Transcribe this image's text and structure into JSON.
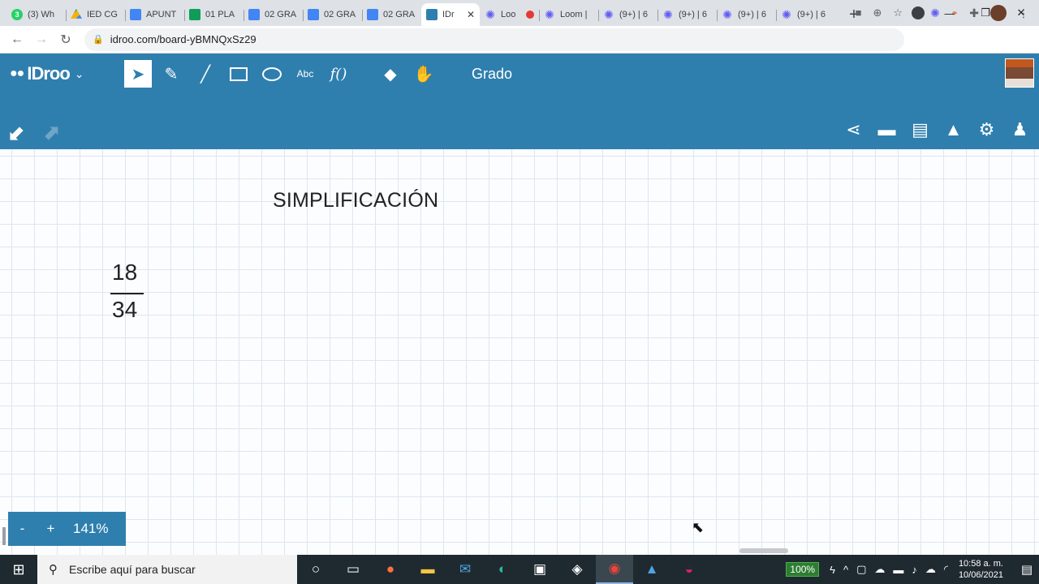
{
  "browser": {
    "tabs": [
      {
        "title": "(3) Wh",
        "icon": "whatsapp-icon",
        "fav": "wa",
        "badge": "3"
      },
      {
        "title": "IED CG",
        "icon": "drive-icon",
        "fav": "drive",
        "badge": ""
      },
      {
        "title": "APUNT",
        "icon": "docs-icon",
        "fav": "doc",
        "badge": ""
      },
      {
        "title": "01 PLA",
        "icon": "sheets-icon",
        "fav": "sheet",
        "badge": ""
      },
      {
        "title": "02 GRA",
        "icon": "docs-icon",
        "fav": "doc",
        "badge": ""
      },
      {
        "title": "02 GRA",
        "icon": "docs-icon",
        "fav": "doc",
        "badge": ""
      },
      {
        "title": "02 GRA",
        "icon": "docs-icon",
        "fav": "doc",
        "badge": ""
      },
      {
        "title": "IDr",
        "icon": "idroo-icon",
        "fav": "idroo",
        "badge": "",
        "active": true
      },
      {
        "title": "Loo",
        "icon": "loom-icon",
        "fav": "loom",
        "badge": "",
        "recording": true
      },
      {
        "title": "Loom |",
        "icon": "loom-icon",
        "fav": "loom",
        "badge": ""
      },
      {
        "title": "(9+) | 6",
        "icon": "loom-icon",
        "fav": "loom",
        "badge": ""
      },
      {
        "title": "(9+) | 6",
        "icon": "loom-icon",
        "fav": "loom",
        "badge": ""
      },
      {
        "title": "(9+) | 6",
        "icon": "loom-icon",
        "fav": "loom",
        "badge": ""
      },
      {
        "title": "(9+) | 6",
        "icon": "loom-icon",
        "fav": "loom",
        "badge": ""
      }
    ],
    "url": "idroo.com/board-yBMNQxSz29"
  },
  "idroo": {
    "logo": "IDroo",
    "board_name": "Grado",
    "tools": [
      "select-tool",
      "pen-tool",
      "line-tool",
      "rectangle-tool",
      "ellipse-tool",
      "text-tool",
      "formula-tool",
      "eraser-tool",
      "hand-tool"
    ],
    "text_tool_label": "Abc",
    "formula_tool_label": "f()",
    "right_tools": [
      "share-icon",
      "chat-icon",
      "document-icon",
      "image-icon",
      "settings-icon",
      "user-edit-icon"
    ]
  },
  "canvas": {
    "title": "SIMPLIFICACIÓN",
    "fraction": {
      "numerator": "18",
      "denominator": "34"
    },
    "zoom": {
      "minus": "-",
      "plus": "+",
      "level": "141%"
    }
  },
  "taskbar": {
    "search_placeholder": "Escribe aquí para buscar",
    "battery": "100%",
    "time": "10:58 a. m.",
    "date": "10/06/2021"
  },
  "colors": {
    "idroo_blue": "#2f7fae",
    "taskbar": "#1f2a30",
    "grid": "#dce6f0"
  }
}
